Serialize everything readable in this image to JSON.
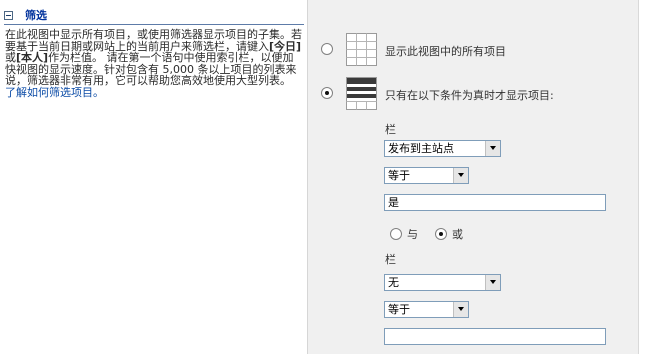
{
  "section": {
    "title": "筛选"
  },
  "description": {
    "text": "在此视图中显示所有项目，或使用筛选器显示项目的子集。若要基于当前日期或网站上的当前用户来筛选栏，请键入",
    "token_today": "[今日]",
    "or_word": "或",
    "token_me": "[本人]",
    "text2": "作为栏值。 请在第一个语句中使用索引栏，以便加快视图的显示速度。针对包含有 5,000 条以上项目的列表来说，筛选器非常有用，它可以帮助您高效地使用大型列表。",
    "link": "了解如何筛选项目。"
  },
  "options": {
    "show_all": {
      "label": "显示此视图中的所有项目",
      "checked": false,
      "icon": "table-grid-icon"
    },
    "show_filtered": {
      "label": "只有在以下条件为真时才显示项目:",
      "checked": true,
      "icon": "table-filter-icon"
    }
  },
  "condition1": {
    "column_label": "栏",
    "column_value": "发布到主站点",
    "operator_value": "等于",
    "value": "是"
  },
  "logic": {
    "and_label": "与",
    "or_label": "或",
    "selected": "or"
  },
  "condition2": {
    "column_label": "栏",
    "column_value": "无",
    "operator_value": "等于",
    "value": ""
  }
}
